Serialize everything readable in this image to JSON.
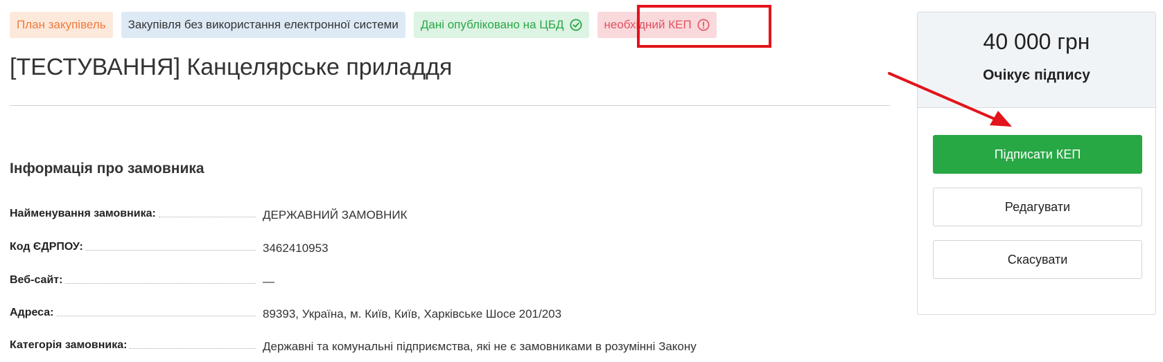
{
  "badges": {
    "plan": "План закупівель",
    "no_system": "Закупівля без використання електронної системи",
    "published": "Дані опубліковано на ЦБД",
    "kep_required": "необхідний КЕП"
  },
  "title": "[ТЕСТУВАННЯ] Канцелярське приладдя",
  "customer_section": {
    "heading": "Інформація про замовника",
    "rows": [
      {
        "label": "Найменування замовника:",
        "value": "ДЕРЖАВНИЙ ЗАМОВНИК"
      },
      {
        "label": "Код ЄДРПОУ:",
        "value": "3462410953"
      },
      {
        "label": "Веб-сайт:",
        "value": "—"
      },
      {
        "label": "Адреса:",
        "value": "89393, Україна, м. Київ, Київ, Харківське Шосе 201/203"
      },
      {
        "label": "Категорія замовника:",
        "value": "Державні та комунальні підприємства, які не є замовниками в розумінні Закону"
      }
    ]
  },
  "panel": {
    "amount": "40 000 грн",
    "status": "Очікує підпису",
    "sign_button": "Підписати КЕП",
    "edit_button": "Редагувати",
    "cancel_button": "Скасувати"
  },
  "icons": {
    "published": "check-circle-icon",
    "kep": "exclamation-circle-icon"
  },
  "colors": {
    "accent_green": "#28a745",
    "highlight_red": "#e3131b"
  }
}
